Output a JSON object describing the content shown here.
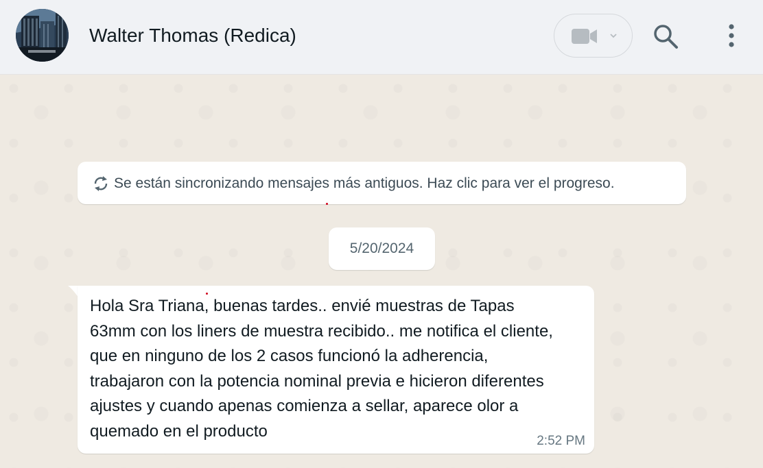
{
  "chat_header": {
    "contact_name": "Walter Thomas (Redica)",
    "avatar_icon": "building-photo-avatar",
    "video_call_icon": "video-camera-icon",
    "dropdown_icon": "chevron-down-icon",
    "search_icon": "search-icon",
    "menu_icon": "vertical-dots-menu-icon"
  },
  "sync_banner": {
    "icon": "sync-icon",
    "text": "Se están sincronizando mensajes más antiguos. Haz clic para ver el progreso."
  },
  "date_separator": {
    "label": "5/20/2024"
  },
  "messages": [
    {
      "direction": "incoming",
      "text": "Hola Sra Triana, buenas tardes.. envié muestras de Tapas 63mm con los liners de muestra recibido.. me notifica el cliente, que en ninguno de los 2 casos funcionó la adherencia, trabajaron con la potencia nominal previa e hicieron diferentes ajustes y cuando apenas comienza a sellar, aparece olor a quemado en el producto",
      "time": "2:52 PM"
    }
  ],
  "colors": {
    "header_bg": "#f0f2f5",
    "chat_bg": "#efeae2",
    "bubble_bg": "#ffffff",
    "icon_color": "#54656f",
    "text_primary": "#111b21",
    "text_secondary": "#667781"
  }
}
